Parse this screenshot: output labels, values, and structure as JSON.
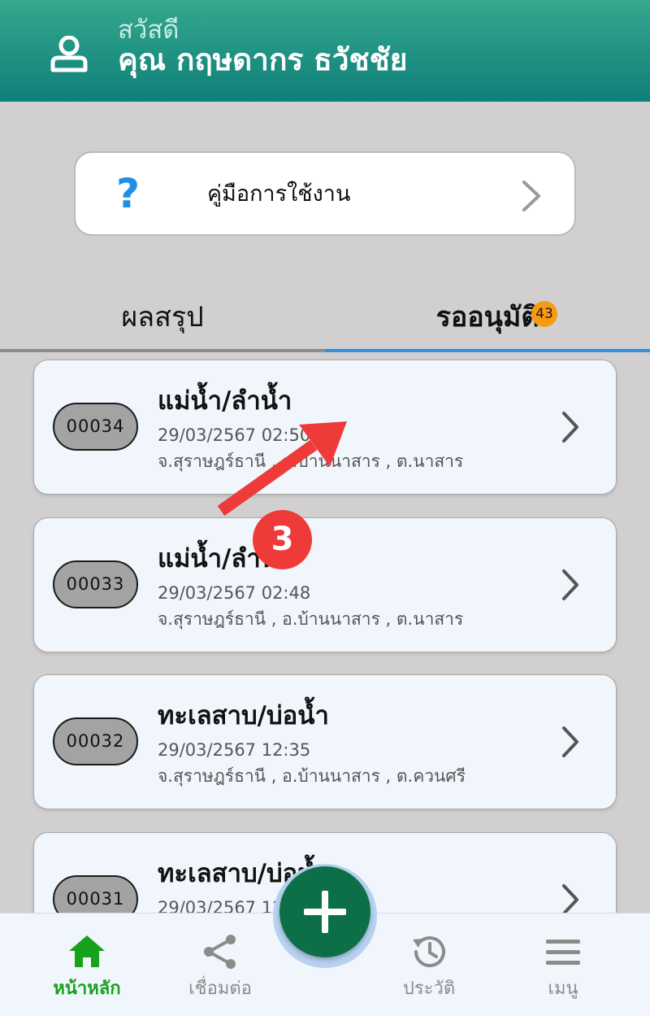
{
  "header": {
    "greeting": "สวัสดี",
    "user_name": "คุณ กฤษดากร ธวัชชัย",
    "icon": "user-icon"
  },
  "guide": {
    "icon": "question-icon",
    "icon_text": "?",
    "label": "คู่มือการใช้งาน"
  },
  "tabs": [
    {
      "label": "ผลสรุป",
      "active": false
    },
    {
      "label": "รออนุมัติ",
      "active": true,
      "badge": "43"
    }
  ],
  "records": [
    {
      "id": "00034",
      "title": "แม่น้ำ/ลำน้ำ",
      "date": "29/03/2567  02:50",
      "location": "จ.สุราษฎร์ธานี , อ.บ้านนาสาร , ต.นาสาร"
    },
    {
      "id": "00033",
      "title": "แม่น้ำ/ลำน้ำ",
      "date": "29/03/2567  02:48",
      "location": "จ.สุราษฎร์ธานี , อ.บ้านนาสาร , ต.นาสาร"
    },
    {
      "id": "00032",
      "title": "ทะเลสาบ/บ่อน้ำ",
      "date": "29/03/2567  12:35",
      "location": "จ.สุราษฎร์ธานี , อ.บ้านนาสาร , ต.ควนศรี"
    },
    {
      "id": "00031",
      "title": "ทะเลสาบ/บ่อน้ำ",
      "date": "29/03/2567  12:",
      "location": ""
    }
  ],
  "annotation": {
    "step": "3",
    "color": "#ef3a3a"
  },
  "bottom_nav": [
    {
      "label": "หน้าหลัก",
      "icon": "home-icon",
      "active": true
    },
    {
      "label": "เชื่อมต่อ",
      "icon": "share-icon",
      "active": false
    },
    {
      "label": "ประวัติ",
      "icon": "history-icon",
      "active": false
    },
    {
      "label": "เมนู",
      "icon": "menu-icon",
      "active": false
    }
  ],
  "fab": {
    "icon": "plus-icon"
  },
  "colors": {
    "header": "#0e7f79",
    "accent_tab": "#2f8fe0",
    "badge": "#f79a13",
    "active_nav": "#17a11c",
    "fab": "#0d6f47"
  }
}
